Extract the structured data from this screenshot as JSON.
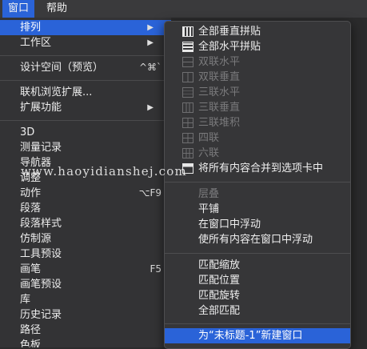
{
  "menubar": {
    "items": [
      {
        "label": "窗口",
        "active": true
      },
      {
        "label": "帮助",
        "active": false
      }
    ]
  },
  "main_menu": {
    "items": [
      {
        "label": "排列",
        "submenu": true,
        "highlighted": true
      },
      {
        "label": "工作区",
        "submenu": true
      },
      {
        "label": "设计空间（预览）",
        "shortcut": "^⌘`"
      },
      {
        "label": "联机浏览扩展..."
      },
      {
        "label": "扩展功能",
        "submenu": true
      },
      {
        "label": "3D"
      },
      {
        "label": "测量记录"
      },
      {
        "label": "导航器"
      },
      {
        "label": "调整"
      },
      {
        "label": "动作",
        "shortcut": "⌥F9"
      },
      {
        "label": "段落"
      },
      {
        "label": "段落样式"
      },
      {
        "label": "仿制源"
      },
      {
        "label": "工具预设"
      },
      {
        "label": "画笔",
        "shortcut": "F5"
      },
      {
        "label": "画笔预设"
      },
      {
        "label": "库"
      },
      {
        "label": "历史记录"
      },
      {
        "label": "路径"
      },
      {
        "label": "色板"
      }
    ]
  },
  "submenu": {
    "items": [
      {
        "label": "全部垂直拼贴",
        "icon": "tile-vertical-icon",
        "enabled": true
      },
      {
        "label": "全部水平拼贴",
        "icon": "tile-horizontal-icon",
        "enabled": true
      },
      {
        "label": "双联水平",
        "icon": "two-up-horizontal-icon",
        "enabled": false
      },
      {
        "label": "双联垂直",
        "icon": "two-up-vertical-icon",
        "enabled": false
      },
      {
        "label": "三联水平",
        "icon": "three-up-horizontal-icon",
        "enabled": false
      },
      {
        "label": "三联垂直",
        "icon": "three-up-vertical-icon",
        "enabled": false
      },
      {
        "label": "三联堆积",
        "icon": "three-up-stacked-icon",
        "enabled": false
      },
      {
        "label": "四联",
        "icon": "four-up-icon",
        "enabled": false
      },
      {
        "label": "六联",
        "icon": "six-up-icon",
        "enabled": false
      },
      {
        "label": "将所有内容合并到选项卡中",
        "icon": "consolidate-tabs-icon",
        "enabled": true
      },
      {
        "label": "层叠",
        "enabled": false
      },
      {
        "label": "平铺",
        "enabled": true
      },
      {
        "label": "在窗口中浮动",
        "enabled": true
      },
      {
        "label": "使所有内容在窗口中浮动",
        "enabled": true
      },
      {
        "label": "匹配缩放",
        "enabled": true
      },
      {
        "label": "匹配位置",
        "enabled": true
      },
      {
        "label": "匹配旋转",
        "enabled": true
      },
      {
        "label": "全部匹配",
        "enabled": true
      },
      {
        "label": "为“未标题-1”新建窗口",
        "enabled": true,
        "highlighted": true
      }
    ]
  },
  "watermark": "www.haoyidianshej.com",
  "colors": {
    "highlight": "#2a63d8",
    "menu_bg": "#333335",
    "disabled_text": "#7a7a7c"
  }
}
